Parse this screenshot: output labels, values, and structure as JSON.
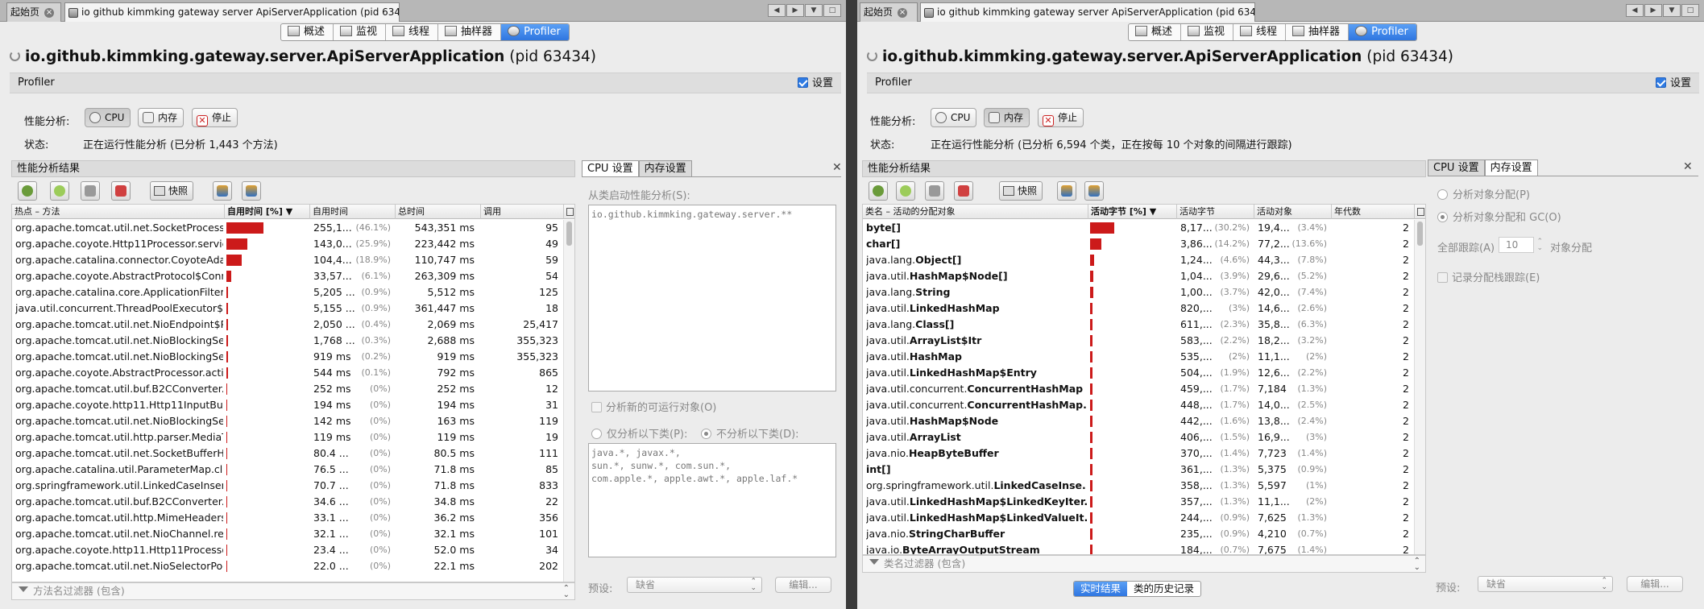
{
  "left": {
    "tabs": [
      {
        "label": "起始页"
      },
      {
        "label": "io github kimmking gateway server ApiServerApplication (pid 63434)"
      }
    ],
    "view_tabs": [
      {
        "label": "概述"
      },
      {
        "label": "监视"
      },
      {
        "label": "线程"
      },
      {
        "label": "抽样器"
      },
      {
        "label": "Profiler"
      }
    ],
    "app_name": "io.github.kimmking.gateway.server.ApiServerApplication",
    "pid": "(pid 63434)",
    "section": "Profiler",
    "settings_label": "设置",
    "perf_label": "性能分析:",
    "buttons": {
      "cpu": "CPU",
      "memory": "内存",
      "stop": "停止"
    },
    "status_label": "状态:",
    "status_text": "正在运行性能分析 (已分析 1,443 个方法)",
    "results_title": "性能分析结果",
    "snapshot": "快照",
    "columns": [
      "热点 – 方法",
      "自用时间 [%]",
      "自用时间",
      "总时间",
      "调用"
    ],
    "rows": [
      {
        "name": "org.apache.tomcat.util.net.SocketProcessorBase.run()",
        "self": "255,1...",
        "pct": "(46.1%)",
        "bar": 0.461,
        "total": "543,351 ms",
        "calls": "95"
      },
      {
        "name": "org.apache.coyote.Http11Processor.service()",
        "self": "143,0...",
        "pct": "(25.9%)",
        "bar": 0.259,
        "total": "223,442 ms",
        "calls": "49"
      },
      {
        "name": "org.apache.catalina.connector.CoyoteAdapter.service()",
        "self": "104,4...",
        "pct": "(18.9%)",
        "bar": 0.189,
        "total": "110,747 ms",
        "calls": "59"
      },
      {
        "name": "org.apache.coyote.AbstractProtocol$ConnectionHandler.process()",
        "self": "33,57...",
        "pct": "(6.1%)",
        "bar": 0.061,
        "total": "263,309 ms",
        "calls": "54"
      },
      {
        "name": "org.apache.catalina.core.ApplicationFilterChain.doFilter()",
        "self": "5,205 ...",
        "pct": "(0.9%)",
        "bar": 0.009,
        "total": "5,512 ms",
        "calls": "125"
      },
      {
        "name": "java.util.concurrent.ThreadPoolExecutor$Worker.run()",
        "self": "5,155 ...",
        "pct": "(0.9%)",
        "bar": 0.009,
        "total": "361,447 ms",
        "calls": "18"
      },
      {
        "name": "org.apache.tomcat.util.net.NioEndpoint$Poller.run()",
        "self": "2,050 ...",
        "pct": "(0.4%)",
        "bar": 0.004,
        "total": "2,069 ms",
        "calls": "25,417"
      },
      {
        "name": "org.apache.tomcat.util.net.NioBlockingSelector.write()",
        "self": "1,768 ...",
        "pct": "(0.3%)",
        "bar": 0.003,
        "total": "2,688 ms",
        "calls": "355,323"
      },
      {
        "name": "org.apache.tomcat.util.net.NioBlockingSelector$BlockPoller.run()",
        "self": "919 ms",
        "pct": "(0.2%)",
        "bar": 0.002,
        "total": "919 ms",
        "calls": "355,323"
      },
      {
        "name": "org.apache.coyote.AbstractProcessor.action()",
        "name_bold": "ac",
        "self": "544 ms",
        "pct": "(0.1%)",
        "bar": 0.001,
        "total": "792 ms",
        "calls": "865"
      },
      {
        "name": "org.apache.tomcat.util.buf.B2CConverter.convert()",
        "self": "252 ms",
        "pct": "(0%)",
        "bar": 0,
        "total": "252 ms",
        "calls": "12"
      },
      {
        "name": "org.apache.coyote.http11.Http11InputBuffer.parseHeaders()",
        "self": "194 ms",
        "pct": "(0%)",
        "bar": 0,
        "total": "194 ms",
        "calls": "31"
      },
      {
        "name": "org.apache.tomcat.util.net.NioBlockingSelector.read()",
        "self": "142 ms",
        "pct": "(0%)",
        "bar": 0,
        "total": "163 ms",
        "calls": "119"
      },
      {
        "name": "org.apache.tomcat.util.http.parser.MediaType.parseMediaType()",
        "self": "119 ms",
        "pct": "(0%)",
        "bar": 0,
        "total": "119 ms",
        "calls": "19"
      },
      {
        "name": "org.apache.tomcat.util.net.SocketBufferHandler.expand()",
        "self": "80.4 ...",
        "pct": "(0%)",
        "bar": 0,
        "total": "80.5 ms",
        "calls": "111"
      },
      {
        "name": "org.apache.catalina.util.ParameterMap.clear()",
        "self": "76.5 ...",
        "pct": "(0%)",
        "bar": 0,
        "total": "71.8 ms",
        "calls": "85"
      },
      {
        "name": "org.springframework.util.LinkedCaseInsensitiveMap.put()",
        "self": "70.7 ...",
        "pct": "(0%)",
        "bar": 0,
        "total": "71.8 ms",
        "calls": "833"
      },
      {
        "name": "org.apache.tomcat.util.buf.B2CConverter.recycle()",
        "self": "34.6 ...",
        "pct": "(0%)",
        "bar": 0,
        "total": "34.8 ms",
        "calls": "22"
      },
      {
        "name": "org.apache.tomcat.util.http.MimeHeaders.getValue()",
        "self": "33.1 ...",
        "pct": "(0%)",
        "bar": 0,
        "total": "36.2 ms",
        "calls": "356"
      },
      {
        "name": "org.apache.tomcat.util.net.NioChannel.read()",
        "self": "32.1 ...",
        "pct": "(0%)",
        "bar": 0,
        "total": "32.1 ms",
        "calls": "101"
      },
      {
        "name": "org.apache.coyote.http11.Http11Processor.prepareResponse()",
        "self": "23.4 ...",
        "pct": "(0%)",
        "bar": 0,
        "total": "52.0 ms",
        "calls": "34"
      },
      {
        "name": "org.apache.tomcat.util.net.NioSelectorPool.write()",
        "self": "22.0 ...",
        "pct": "(0%)",
        "bar": 0,
        "total": "22.1 ms",
        "calls": "202"
      }
    ],
    "filter_placeholder": "方法名过滤器 (包含)",
    "settings_tabs": [
      {
        "label": "CPU 设置"
      },
      {
        "label": "内存设置"
      }
    ],
    "from_class_label": "从类启动性能分析(S):",
    "from_class_value": "io.github.kimmking.gateway.server.**",
    "new_runnable": "分析新的可运行对象(O)",
    "only_classes": "仅分析以下类(P):",
    "exclude_classes": "不分析以下类(D):",
    "exclude_value": "java.*, javax.*,\nsun.*, sunw.*, com.sun.*,\ncom.apple.*, apple.awt.*, apple.laf.*",
    "preset_label": "预设:",
    "preset_value": "缺省",
    "edit_button": "编辑..."
  },
  "right": {
    "tabs": [
      {
        "label": "起始页"
      },
      {
        "label": "io github kimmking gateway server ApiServerApplication (pid 63434)"
      }
    ],
    "view_tabs": [
      {
        "label": "概述"
      },
      {
        "label": "监视"
      },
      {
        "label": "线程"
      },
      {
        "label": "抽样器"
      },
      {
        "label": "Profiler"
      }
    ],
    "app_name": "io.github.kimmking.gateway.server.ApiServerApplication",
    "pid": "(pid 63434)",
    "section": "Profiler",
    "settings_label": "设置",
    "perf_label": "性能分析:",
    "buttons": {
      "cpu": "CPU",
      "memory": "内存",
      "stop": "停止"
    },
    "status_label": "状态:",
    "status_text": "正在运行性能分析 (已分析 6,594 个类，正在按每 10 个对象的间隔进行跟踪)",
    "results_title": "性能分析结果",
    "snapshot": "快照",
    "columns": [
      "类名 – 活动的分配对象",
      "活动字节 [%]",
      "活动字节",
      "活动对象",
      "年代数"
    ],
    "rows": [
      {
        "pkg": "",
        "cls": "byte[]",
        "bytes": "8,17...",
        "bpct": "(30.2%)",
        "bar": 0.302,
        "objs": "19,4...",
        "opct": "(3.4%)",
        "gen": "2"
      },
      {
        "pkg": "",
        "cls": "char[]",
        "bytes": "3,86...",
        "bpct": "(14.2%)",
        "bar": 0.142,
        "objs": "77,2...",
        "opct": "(13.6%)",
        "gen": "2"
      },
      {
        "pkg": "java.lang.",
        "cls": "Object[]",
        "bytes": "1,24...",
        "bpct": "(4.6%)",
        "bar": 0.046,
        "objs": "44,3...",
        "opct": "(7.8%)",
        "gen": "2"
      },
      {
        "pkg": "java.util.",
        "cls": "HashMap$Node[]",
        "bytes": "1,04...",
        "bpct": "(3.9%)",
        "bar": 0.039,
        "objs": "29,6...",
        "opct": "(5.2%)",
        "gen": "2"
      },
      {
        "pkg": "java.lang.",
        "cls": "String",
        "bytes": "1,00...",
        "bpct": "(3.7%)",
        "bar": 0.037,
        "objs": "42,0...",
        "opct": "(7.4%)",
        "gen": "2"
      },
      {
        "pkg": "java.util.",
        "cls": "LinkedHashMap",
        "bytes": "820,...",
        "bpct": "(3%)",
        "bar": 0.03,
        "objs": "14,6...",
        "opct": "(2.6%)",
        "gen": "2"
      },
      {
        "pkg": "java.lang.",
        "cls": "Class[]",
        "bytes": "611,...",
        "bpct": "(2.3%)",
        "bar": 0.023,
        "objs": "35,8...",
        "opct": "(6.3%)",
        "gen": "2"
      },
      {
        "pkg": "java.util.",
        "cls": "ArrayList$Itr",
        "bytes": "583,...",
        "bpct": "(2.2%)",
        "bar": 0.022,
        "objs": "18,2...",
        "opct": "(3.2%)",
        "gen": "2"
      },
      {
        "pkg": "java.util.",
        "cls": "HashMap",
        "bytes": "535,...",
        "bpct": "(2%)",
        "bar": 0.02,
        "objs": "11,1...",
        "opct": "(2%)",
        "gen": "2"
      },
      {
        "pkg": "java.util.",
        "cls": "LinkedHashMap$Entry",
        "bytes": "504,...",
        "bpct": "(1.9%)",
        "bar": 0.019,
        "objs": "12,6...",
        "opct": "(2.2%)",
        "gen": "2"
      },
      {
        "pkg": "java.util.concurrent.",
        "cls": "ConcurrentHashMap",
        "bytes": "459,...",
        "bpct": "(1.7%)",
        "bar": 0.017,
        "objs": "7,184",
        "opct": "(1.3%)",
        "gen": "2"
      },
      {
        "pkg": "java.util.concurrent.",
        "cls": "ConcurrentHashMap...",
        "bytes": "448,...",
        "bpct": "(1.7%)",
        "bar": 0.017,
        "objs": "14,0...",
        "opct": "(2.5%)",
        "gen": "2"
      },
      {
        "pkg": "java.util.",
        "cls": "HashMap$Node",
        "bytes": "442,...",
        "bpct": "(1.6%)",
        "bar": 0.016,
        "objs": "13,8...",
        "opct": "(2.4%)",
        "gen": "2"
      },
      {
        "pkg": "java.util.",
        "cls": "ArrayList",
        "bytes": "406,...",
        "bpct": "(1.5%)",
        "bar": 0.015,
        "objs": "16,9...",
        "opct": "(3%)",
        "gen": "2"
      },
      {
        "pkg": "java.nio.",
        "cls": "HeapByteBuffer",
        "bytes": "370,...",
        "bpct": "(1.4%)",
        "bar": 0.014,
        "objs": "7,723",
        "opct": "(1.4%)",
        "gen": "2"
      },
      {
        "pkg": "",
        "cls": "int[]",
        "bytes": "361,...",
        "bpct": "(1.3%)",
        "bar": 0.013,
        "objs": "5,375",
        "opct": "(0.9%)",
        "gen": "2"
      },
      {
        "pkg": "org.springframework.util.",
        "cls": "LinkedCaseInse...",
        "bytes": "358,...",
        "bpct": "(1.3%)",
        "bar": 0.013,
        "objs": "5,597",
        "opct": "(1%)",
        "gen": "2"
      },
      {
        "pkg": "java.util.",
        "cls": "LinkedHashMap$LinkedKeyIter...",
        "bytes": "357,...",
        "bpct": "(1.3%)",
        "bar": 0.013,
        "objs": "11,1...",
        "opct": "(2%)",
        "gen": "2"
      },
      {
        "pkg": "java.util.",
        "cls": "LinkedHashMap$LinkedValueIt...",
        "bytes": "244,...",
        "bpct": "(0.9%)",
        "bar": 0.009,
        "objs": "7,625",
        "opct": "(1.3%)",
        "gen": "2"
      },
      {
        "pkg": "java.nio.",
        "cls": "StringCharBuffer",
        "bytes": "235,...",
        "bpct": "(0.9%)",
        "bar": 0.009,
        "objs": "4,210",
        "opct": "(0.7%)",
        "gen": "2"
      },
      {
        "pkg": "java.io.",
        "cls": "ByteArrayOutputStream",
        "bytes": "184,...",
        "bpct": "(0.7%)",
        "bar": 0.007,
        "objs": "7,675",
        "opct": "(1.4%)",
        "gen": "2"
      }
    ],
    "filter_placeholder": "类名过滤器 (包含)",
    "settings_tabs": [
      {
        "label": "CPU 设置"
      },
      {
        "label": "内存设置"
      }
    ],
    "alloc_only": "分析对象分配(P)",
    "alloc_gc": "分析对象分配和 GC(O)",
    "track_all": "全部跟踪(A)",
    "track_value": "10",
    "track_suffix": "对象分配",
    "record_stack": "记录分配栈跟踪(E)",
    "preset_label": "预设:",
    "preset_value": "缺省",
    "edit_button": "编辑...",
    "bottom_tabs": [
      {
        "label": "实时结果"
      },
      {
        "label": "类的历史记录"
      }
    ]
  }
}
